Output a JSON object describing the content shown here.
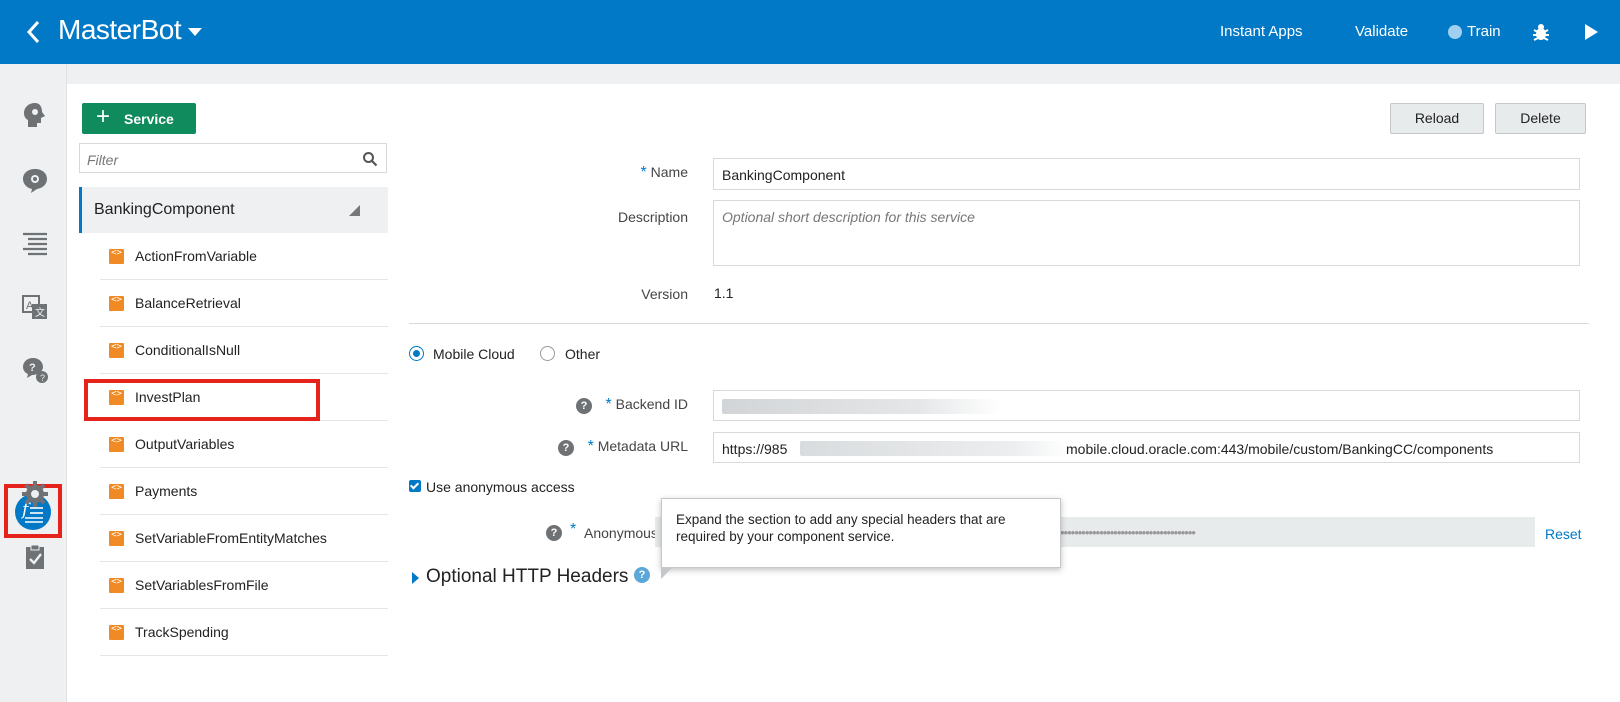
{
  "topbar": {
    "title": "MasterBot",
    "links": [
      "Instant Apps",
      "Validate",
      "Train"
    ]
  },
  "sidebar_icons": [
    "intents-icon",
    "entities-icon",
    "flows-icon",
    "resource-bundle-icon",
    "qna-icon",
    "components-icon",
    "settings-icon",
    "quality-icon"
  ],
  "left_panel": {
    "add_service_label": "Service",
    "filter_placeholder": "Filter",
    "group": "BankingComponent",
    "items": [
      "ActionFromVariable",
      "BalanceRetrieval",
      "ConditionalIsNull",
      "InvestPlan",
      "OutputVariables",
      "Payments",
      "SetVariableFromEntityMatches",
      "SetVariablesFromFile",
      "TrackSpending"
    ]
  },
  "actions": {
    "reload": "Reload",
    "delete": "Delete"
  },
  "form": {
    "name_label": "Name",
    "name_value": "BankingComponent",
    "description_label": "Description",
    "description_placeholder": "Optional short description for this service",
    "version_label": "Version",
    "version_value": "1.1",
    "radio_mobile_cloud": "Mobile Cloud",
    "radio_other": "Other",
    "backend_id_label": "Backend ID",
    "metadata_url_label": "Metadata URL",
    "metadata_url_visible": "https://985",
    "metadata_url_tail": "mobile.cloud.oracle.com:443/mobile/custom/BankingCC/components",
    "anon_checkbox_label": "Use anonymous access",
    "anon_label": "Anonymous",
    "reset_label": "Reset",
    "optional_headers_label": "Optional HTTP Headers"
  },
  "tooltip": {
    "text": "Expand the section to add any special headers that are required by your component service."
  },
  "colors": {
    "brand_blue": "#0179c6",
    "add_green": "#108b5e",
    "highlight_red": "#e5231b",
    "component_orange": "#f08a24"
  }
}
